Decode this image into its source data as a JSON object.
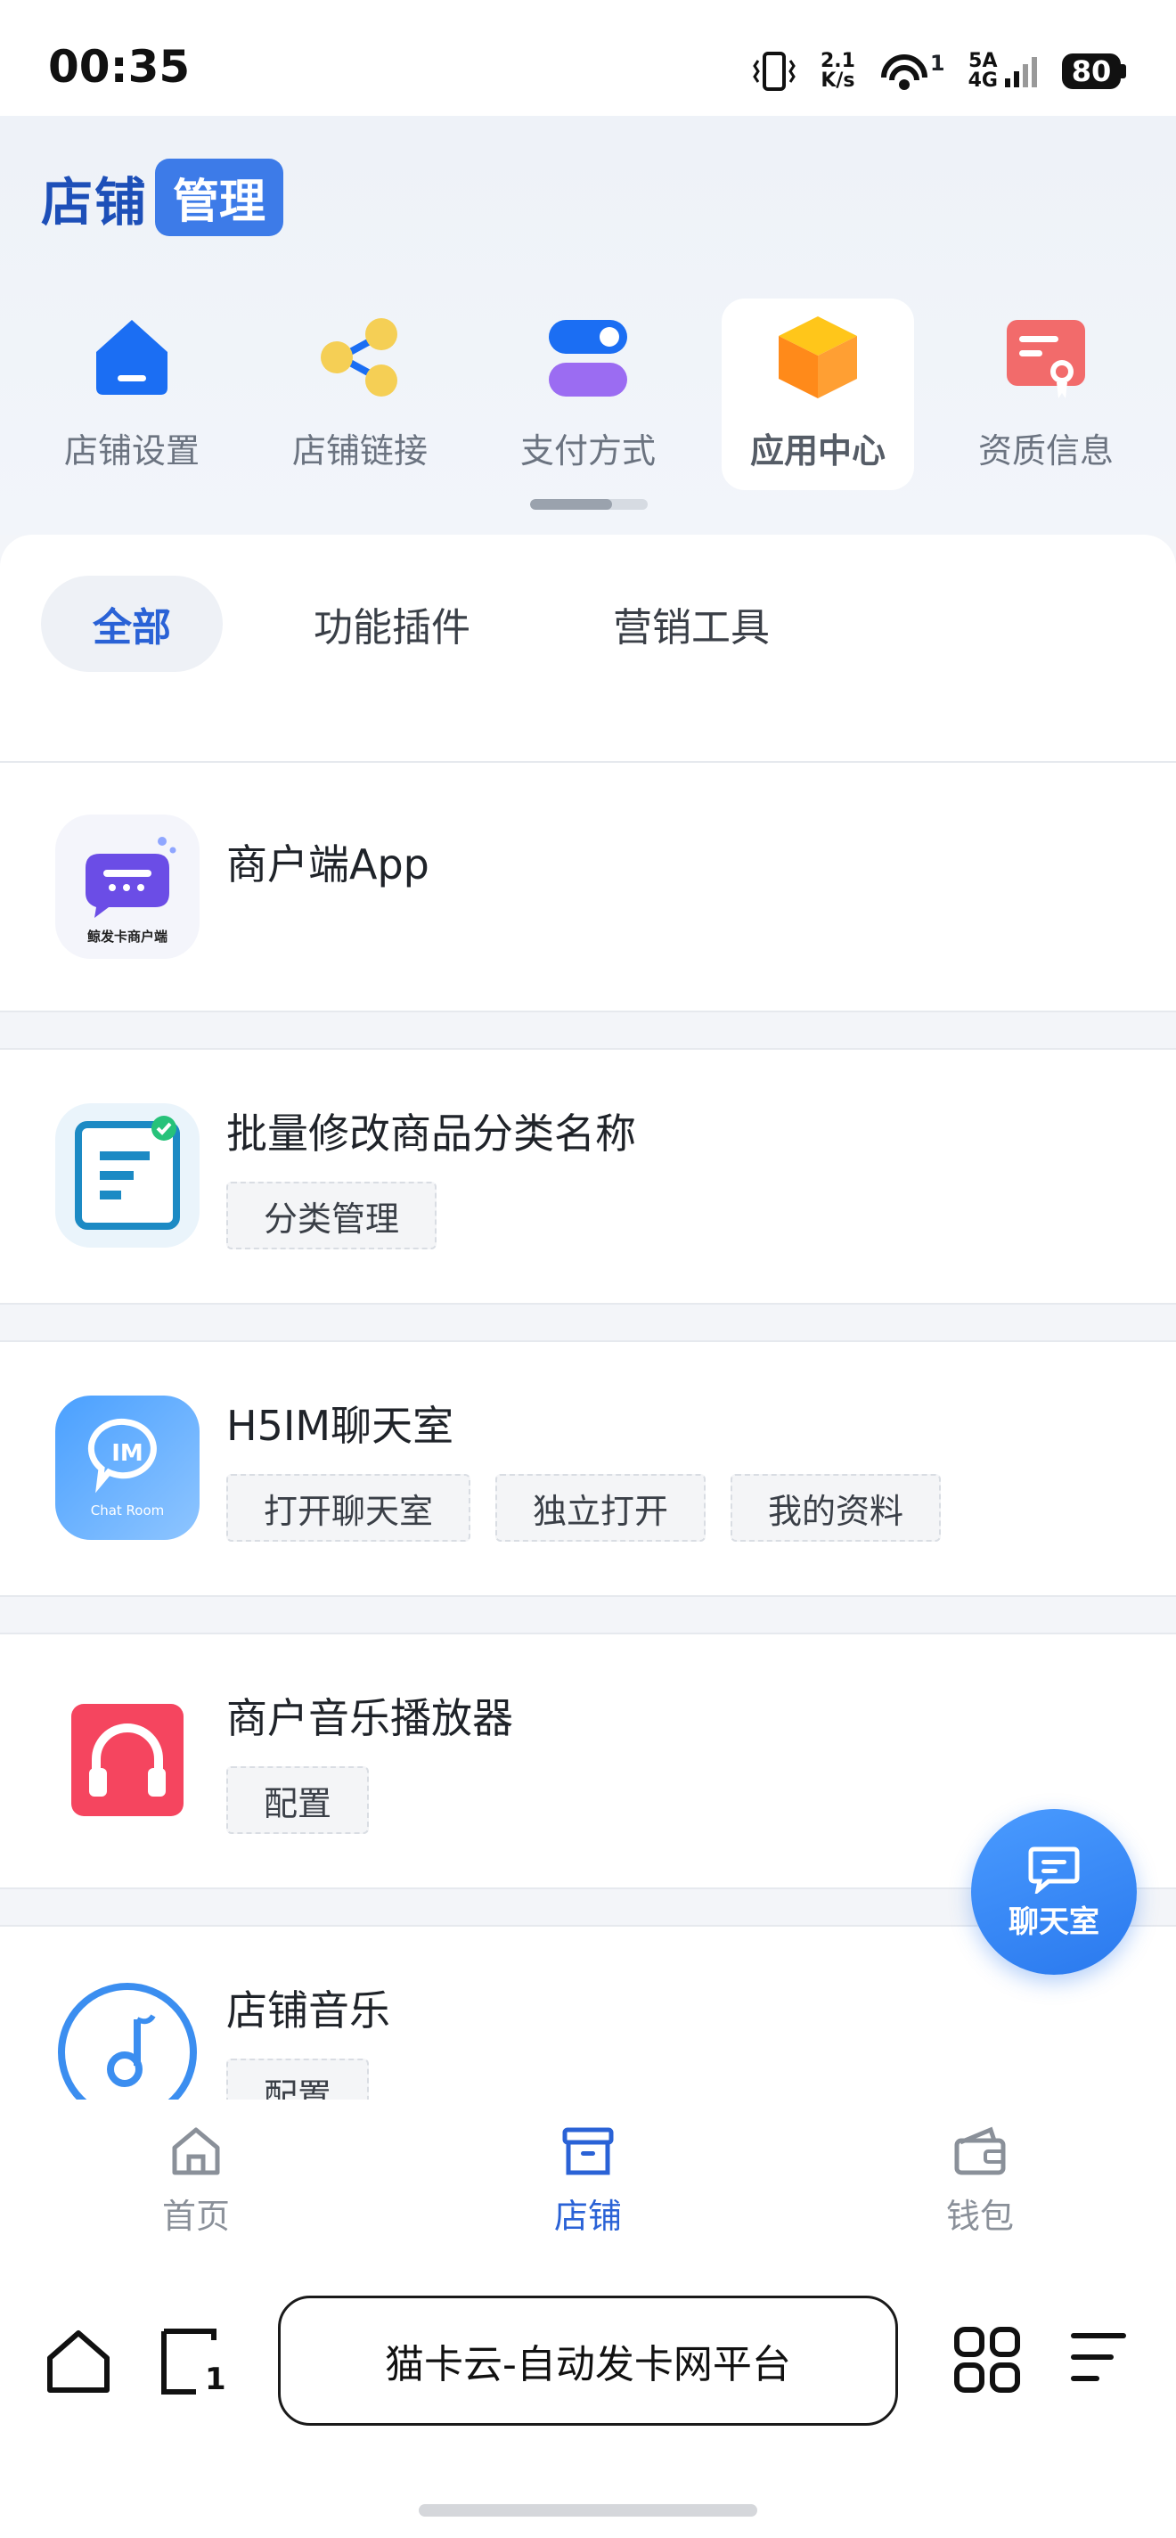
{
  "status": {
    "time": "00:35",
    "net_speed": "2.1",
    "net_unit": "K/s",
    "wifi_badge": "1",
    "sim_line1": "5A",
    "sim_line2": "4G",
    "battery": "80"
  },
  "header": {
    "brand_main": "店铺",
    "brand_badge": "管理"
  },
  "quick_nav": [
    {
      "label": "店铺设置",
      "icon": "store-settings-icon",
      "color": "#1b6ef3"
    },
    {
      "label": "店铺链接",
      "icon": "share-link-icon",
      "color": "#f5cf55"
    },
    {
      "label": "支付方式",
      "icon": "payment-toggle-icon",
      "color": "#1b6ef3"
    },
    {
      "label": "应用中心",
      "icon": "app-center-cube-icon",
      "color": "#ff9a1f"
    },
    {
      "label": "资质信息",
      "icon": "certificate-icon",
      "color": "#f26b6b"
    }
  ],
  "filter_tabs": [
    "全部",
    "功能插件",
    "营销工具"
  ],
  "apps": [
    {
      "name": "商户端App",
      "icon_caption": "鲸发卡商户端",
      "chips": []
    },
    {
      "name": "批量修改商品分类名称",
      "chips": [
        "分类管理"
      ]
    },
    {
      "name": "H5IM聊天室",
      "icon_caption": "Chat Room",
      "chips": [
        "打开聊天室",
        "独立打开",
        "我的资料"
      ]
    },
    {
      "name": "商户音乐播放器",
      "chips": [
        "配置"
      ]
    },
    {
      "name": "店铺音乐",
      "chips": [
        "配置"
      ]
    }
  ],
  "fab": {
    "label": "聊天室"
  },
  "bottom_nav": [
    {
      "label": "首页"
    },
    {
      "label": "店铺"
    },
    {
      "label": "钱包"
    }
  ],
  "browser": {
    "url_title": "猫卡云-自动发卡网平台",
    "tab_count": "1"
  },
  "colors": {
    "accent": "#2a62d6",
    "brand": "#1d4fb8",
    "fab": "#2a79ee"
  }
}
